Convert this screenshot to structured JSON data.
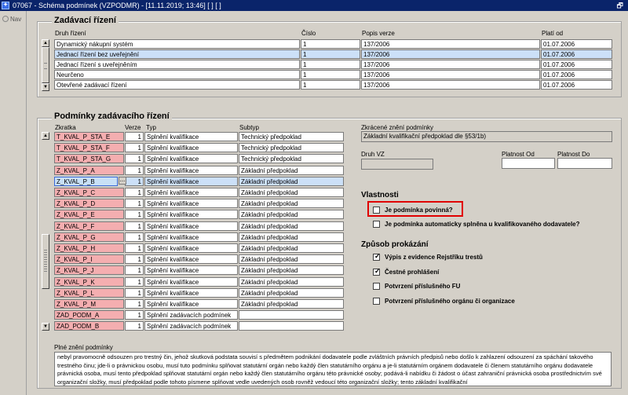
{
  "window": {
    "app_icon": "app-logo-icon",
    "title": "07067 - Schéma podmínek (VZPODMR) - [11.11.2019; 13:46] [ ] [ ]",
    "restore_glyph": "🗗"
  },
  "nav": {
    "label": "Nav"
  },
  "zadavaci": {
    "title": "Zadávací řízení",
    "headers": {
      "druh": "Druh řízení",
      "cislo": "Číslo",
      "popis": "Popis verze",
      "platnost": "Platí od"
    },
    "rows": [
      {
        "druh": "Dynamický nákupní systém",
        "cislo": "1",
        "popis": "137/2006",
        "platnost": "01.07.2006"
      },
      {
        "druh": "Jednací řízení bez uveřejnění",
        "cislo": "1",
        "popis": "137/2006",
        "platnost": "01.07.2006"
      },
      {
        "druh": "Jednací řízení s uveřejněním",
        "cislo": "1",
        "popis": "137/2006",
        "platnost": "01.07.2006"
      },
      {
        "druh": "Neurčeno",
        "cislo": "1",
        "popis": "137/2006",
        "platnost": "01.07.2006"
      },
      {
        "druh": "Otevřené zadávací řízení",
        "cislo": "1",
        "popis": "137/2006",
        "platnost": "01.07.2006"
      }
    ],
    "selected_row": 1
  },
  "podminky": {
    "title": "Podmínky zadávacího řízení",
    "headers": {
      "zkratka": "Zkratka",
      "verze": "Verze",
      "typ": "Typ",
      "subtyp": "Subtyp"
    },
    "rows": [
      {
        "zkratka": "T_KVAL_P_STA_E",
        "verze": "1",
        "typ": "Splnění kvalifikace",
        "subtyp": "Technický předpoklad"
      },
      {
        "zkratka": "T_KVAL_P_STA_F",
        "verze": "1",
        "typ": "Splnění kvalifikace",
        "subtyp": "Technický předpoklad"
      },
      {
        "zkratka": "T_KVAL_P_STA_G",
        "verze": "1",
        "typ": "Splnění kvalifikace",
        "subtyp": "Technický předpoklad"
      },
      {
        "zkratka": "Z_KVAL_P_A",
        "verze": "1",
        "typ": "Splnění kvalifikace",
        "subtyp": "Základní předpoklad"
      },
      {
        "zkratka": "Z_KVAL_P_B",
        "verze": "1",
        "typ": "Splnění kvalifikace",
        "subtyp": "Základní předpoklad"
      },
      {
        "zkratka": "Z_KVAL_P_C",
        "verze": "1",
        "typ": "Splnění kvalifikace",
        "subtyp": "Základní předpoklad"
      },
      {
        "zkratka": "Z_KVAL_P_D",
        "verze": "1",
        "typ": "Splnění kvalifikace",
        "subtyp": "Základní předpoklad"
      },
      {
        "zkratka": "Z_KVAL_P_E",
        "verze": "1",
        "typ": "Splnění kvalifikace",
        "subtyp": "Základní předpoklad"
      },
      {
        "zkratka": "Z_KVAL_P_F",
        "verze": "1",
        "typ": "Splnění kvalifikace",
        "subtyp": "Základní předpoklad"
      },
      {
        "zkratka": "Z_KVAL_P_G",
        "verze": "1",
        "typ": "Splnění kvalifikace",
        "subtyp": "Základní předpoklad"
      },
      {
        "zkratka": "Z_KVAL_P_H",
        "verze": "1",
        "typ": "Splnění kvalifikace",
        "subtyp": "Základní předpoklad"
      },
      {
        "zkratka": "Z_KVAL_P_I",
        "verze": "1",
        "typ": "Splnění kvalifikace",
        "subtyp": "Základní předpoklad"
      },
      {
        "zkratka": "Z_KVAL_P_J",
        "verze": "1",
        "typ": "Splnění kvalifikace",
        "subtyp": "Základní předpoklad"
      },
      {
        "zkratka": "Z_KVAL_P_K",
        "verze": "1",
        "typ": "Splnění kvalifikace",
        "subtyp": "Základní předpoklad"
      },
      {
        "zkratka": "Z_KVAL_P_L",
        "verze": "1",
        "typ": "Splnění kvalifikace",
        "subtyp": "Základní předpoklad"
      },
      {
        "zkratka": "Z_KVAL_P_M",
        "verze": "1",
        "typ": "Splnění kvalifikace",
        "subtyp": "Základní předpoklad"
      },
      {
        "zkratka": "ZAD_PODM_A",
        "verze": "1",
        "typ": "Splnění zadávacích podmínek",
        "subtyp": ""
      },
      {
        "zkratka": "ZAD_PODM_B",
        "verze": "1",
        "typ": "Splnění zadávacích podmínek",
        "subtyp": ""
      }
    ],
    "selected_row": 4,
    "ellipsis": "..."
  },
  "detail": {
    "zkracene_label": "Zkrácené znění podmínky",
    "zkracene_value": "Základní kvalifikační předpoklad dle §53/1b)",
    "druh_vz_label": "Druh VZ",
    "druh_vz_value": "",
    "platnost_od_label": "Platnost Od",
    "platnost_od_value": "",
    "platnost_do_label": "Platnost Do",
    "platnost_do_value": ""
  },
  "vlastnosti": {
    "title": "Vlastnosti",
    "items": [
      {
        "label": "Je podmínka povinná?",
        "checked": false
      },
      {
        "label": "Je podmínka automaticky splněna u kvalifikovaného dodavatele?",
        "checked": false
      }
    ]
  },
  "zpusob": {
    "title": "Způsob prokázání",
    "items": [
      {
        "label": "Výpis z evidence Rejstříku trestů",
        "checked": true
      },
      {
        "label": "Čestné prohlášení",
        "checked": true
      },
      {
        "label": "Potvrzení příslušného FU",
        "checked": false
      },
      {
        "label": "Potvrzení příslušného orgánu či organizace",
        "checked": false
      }
    ]
  },
  "plne": {
    "label": "Plné znění podmínky",
    "text": "nebyl pravomocně odsouzen pro trestný čin, jehož skutková podstata souvisí s předmětem podnikání dodavatele podle zvláštních právních předpisů nebo došlo k zahlazení odsouzení za spáchání takového trestného činu; jde-li o právnickou osobu, musí tuto podmínku splňovat statutární orgán nebo každý člen statutárního orgánu a je-li statutárním orgánem dodavatele či členem statutárního orgánu dodavatele právnická osoba, musí tento předpoklad splňovat statutární orgán nebo každý člen statutárního orgánu této právnické osoby; podává-li nabídku či žádost o účast zahraniční právnická osoba prostřednictvím své organizační složky, musí předpoklad podle tohoto písmene splňovat vedle uvedených osob rovněž vedoucí této organizační složky; tento základní kvalifikační"
  },
  "icons": {
    "scroll_up": "▲",
    "scroll_down": "▼",
    "check": "✓"
  }
}
